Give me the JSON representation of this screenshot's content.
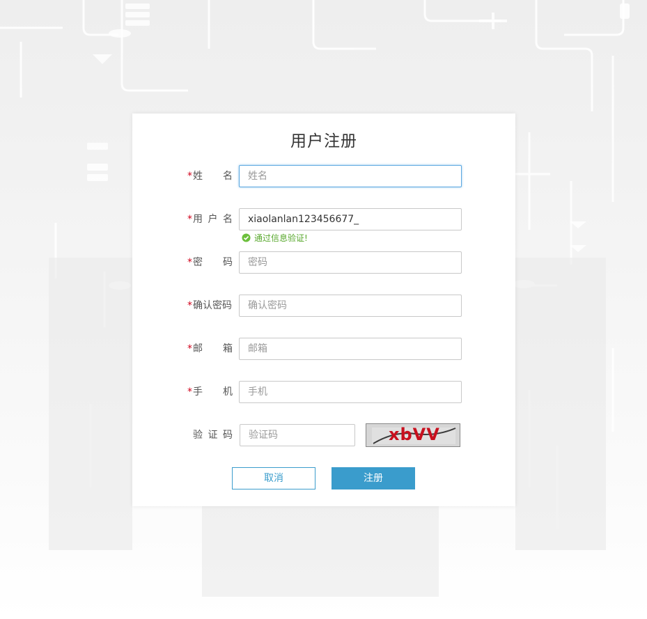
{
  "form": {
    "title": "用户注册",
    "fields": {
      "name": {
        "required_mark": "*",
        "label_chars": [
          "姓",
          "名"
        ],
        "placeholder": "姓名",
        "value": ""
      },
      "username": {
        "required_mark": "*",
        "label_chars": [
          "用",
          "户",
          "名"
        ],
        "placeholder": "",
        "value": "xiaolanlan123456677_",
        "validation": "通过信息验证!"
      },
      "password": {
        "required_mark": "*",
        "label_chars": [
          "密",
          "码"
        ],
        "placeholder": "密码",
        "value": ""
      },
      "confirm_password": {
        "required_mark": "*",
        "label_chars": [
          "确认密码"
        ],
        "placeholder": "确认密码",
        "value": ""
      },
      "email": {
        "required_mark": "*",
        "label_chars": [
          "邮",
          "箱"
        ],
        "placeholder": "邮箱",
        "value": ""
      },
      "phone": {
        "required_mark": "*",
        "label_chars": [
          "手",
          "机"
        ],
        "placeholder": "手机",
        "value": ""
      },
      "captcha": {
        "label_chars": [
          "验",
          "证",
          "码"
        ],
        "placeholder": "验证码",
        "value": "",
        "image_text": "xbVV"
      }
    },
    "buttons": {
      "cancel": "取消",
      "submit": "注册"
    }
  },
  "colors": {
    "required": "#d0021b",
    "accent": "#3a9ccc",
    "success": "#58a82d",
    "captcha_text": "#c8101e"
  },
  "icons": {
    "validation": "check-circle-icon"
  }
}
